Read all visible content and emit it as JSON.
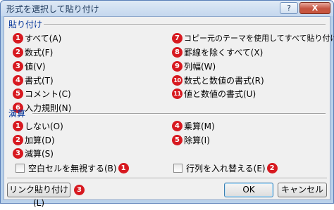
{
  "window": {
    "title": "形式を選択して貼り付け",
    "help_label": "?",
    "close_label": "X"
  },
  "paste": {
    "heading": "貼り付け",
    "options": [
      {
        "num": "1",
        "label": "すべて(A)"
      },
      {
        "num": "2",
        "label": "数式(F)"
      },
      {
        "num": "3",
        "label": "値(V)"
      },
      {
        "num": "4",
        "label": "書式(T)"
      },
      {
        "num": "5",
        "label": "コメント(C)"
      },
      {
        "num": "6",
        "label": "入力規則(N)"
      },
      {
        "num": "7",
        "label": "コピー元のテーマを使用してすべて貼り付け(H)"
      },
      {
        "num": "8",
        "label": "罫線を除くすべて(X)"
      },
      {
        "num": "9",
        "label": "列幅(W)"
      },
      {
        "num": "10",
        "label": "数式と数値の書式(R)"
      },
      {
        "num": "11",
        "label": "値と数値の書式(U)"
      }
    ]
  },
  "operation": {
    "heading": "演算",
    "options": [
      {
        "num": "1",
        "label": "しない(O)"
      },
      {
        "num": "2",
        "label": "加算(D)"
      },
      {
        "num": "3",
        "label": "減算(S)"
      },
      {
        "num": "4",
        "label": "乗算(M)"
      },
      {
        "num": "5",
        "label": "除算(I)"
      }
    ]
  },
  "checkboxes": {
    "skip_blanks": {
      "label": "空白セルを無視する(B)",
      "num": "1"
    },
    "transpose": {
      "label": "行列を入れ替える(E)",
      "num": "2"
    }
  },
  "buttons": {
    "paste_link": {
      "label": "リンク貼り付け(L)",
      "num": "3"
    },
    "ok": "OK",
    "cancel": "キャンセル"
  }
}
